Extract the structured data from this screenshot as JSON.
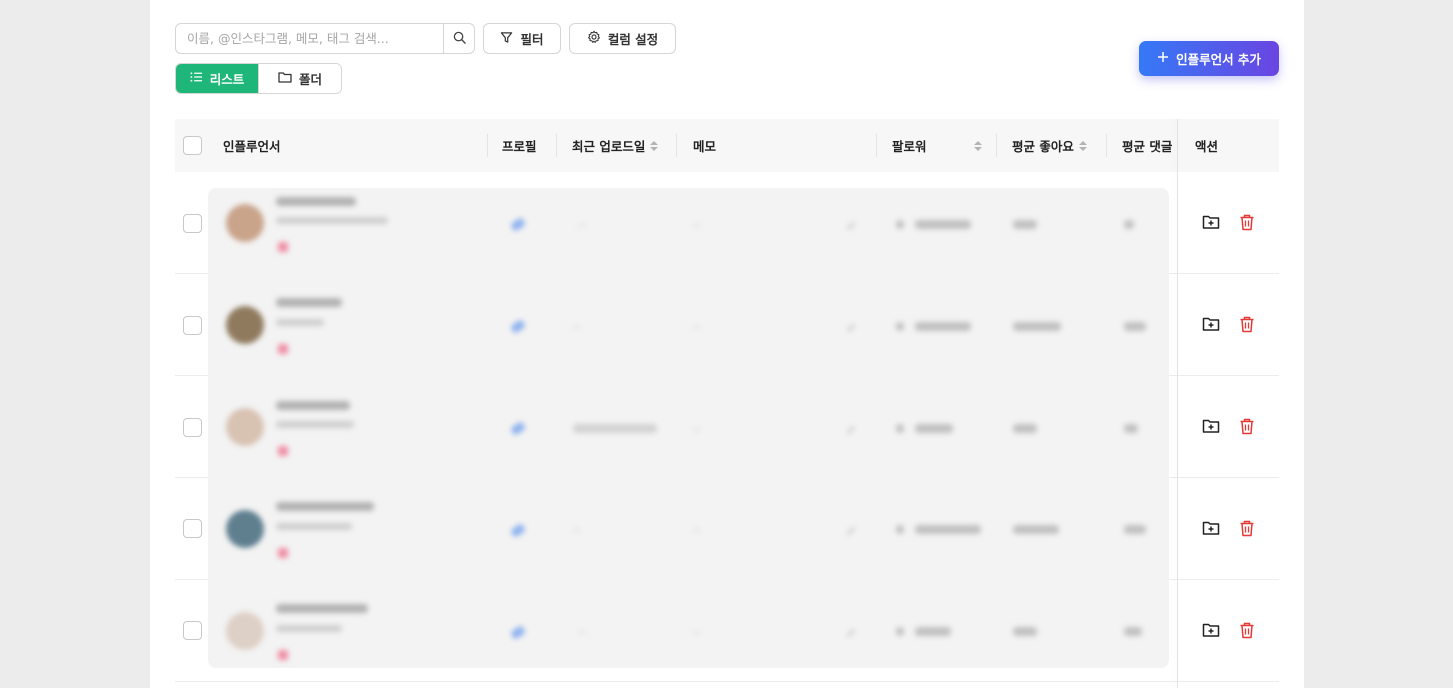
{
  "toolbar": {
    "search_placeholder": "이름, @인스타그램, 메모, 태그 검색...",
    "search_icon": "search-icon",
    "filter_label": "필터",
    "column_settings_label": "컬럼 설정",
    "add_influencer_label": "인플루언서 추가"
  },
  "view_toggle": {
    "list_label": "리스트",
    "folder_label": "폴더",
    "active": "list"
  },
  "table": {
    "columns": {
      "influencer": "인플루언서",
      "profile": "프로필",
      "recent_upload": "최근 업로드일",
      "memo": "메모",
      "followers": "팔로워",
      "avg_likes": "평균 좋아요",
      "avg_comments": "평균 댓글",
      "actions": "액션"
    },
    "row_count": 5,
    "row_actions": [
      "folder-add-icon",
      "trash-icon"
    ]
  },
  "colors": {
    "accent_green": "#1fb67a",
    "add_button_gradient_start": "#3579f6",
    "add_button_gradient_end": "#6a45e2",
    "delete_red": "#e53935"
  }
}
